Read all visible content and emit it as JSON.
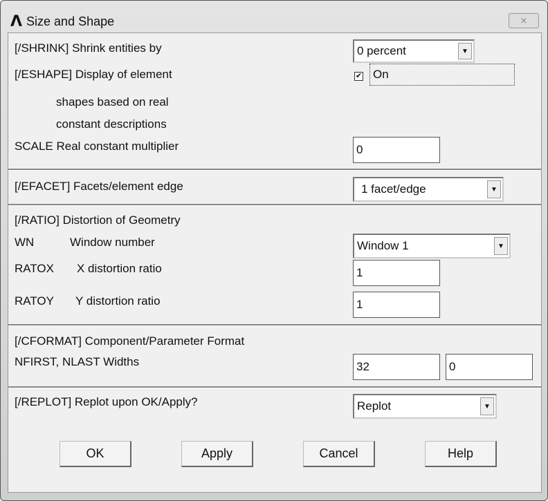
{
  "window": {
    "title": "Size and Shape",
    "logo": "Λ",
    "close": "⨯"
  },
  "shrink": {
    "label": "[/SHRINK]  Shrink entities by",
    "value": "0 percent"
  },
  "eshape": {
    "label": "[/ESHAPE]  Display of element",
    "line2": "shapes based on real",
    "line3": "constant descriptions",
    "checkbox_label": "On",
    "checked": true
  },
  "scale": {
    "label": "SCALE   Real constant multiplier",
    "value": "0"
  },
  "efacet": {
    "label": "[/EFACET]  Facets/element edge",
    "value": "1 facet/edge"
  },
  "ratio": {
    "label": "[/RATIO]  Distortion of Geometry",
    "wn_key": "WN",
    "wn_label": "Window number",
    "wn_value": "Window 1",
    "ratox_key": "RATOX",
    "ratox_label": "X distortion ratio",
    "ratox_value": "1",
    "ratoy_key": "RATOY",
    "ratoy_label": "Y distortion ratio",
    "ratoy_value": "1"
  },
  "cformat": {
    "label": "[/CFORMAT]  Component/Parameter Format",
    "widths_label": "NFIRST, NLAST Widths",
    "nfirst": "32",
    "nlast": "0"
  },
  "replot": {
    "label": "[/REPLOT] Replot upon OK/Apply?",
    "value": "Replot"
  },
  "buttons": {
    "ok": "OK",
    "apply": "Apply",
    "cancel": "Cancel",
    "help": "Help"
  }
}
